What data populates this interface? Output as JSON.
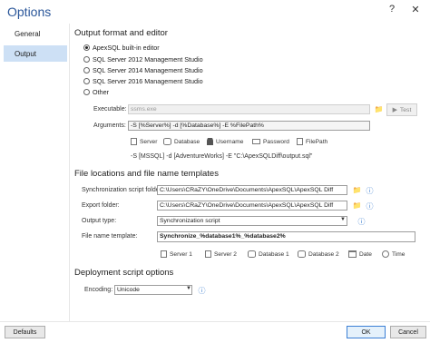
{
  "window": {
    "title": "Options",
    "help_icon": "?",
    "close_icon": "✕"
  },
  "sidebar": {
    "items": [
      {
        "label": "General",
        "active": false
      },
      {
        "label": "Output",
        "active": true
      }
    ]
  },
  "output_section": {
    "title": "Output format and editor",
    "options": [
      {
        "label": "ApexSQL built-in editor",
        "selected": true
      },
      {
        "label": "SQL Server 2012 Management Studio",
        "selected": false
      },
      {
        "label": "SQL Server 2014 Management Studio",
        "selected": false
      },
      {
        "label": "SQL Server 2016 Management Studio",
        "selected": false
      },
      {
        "label": "Other",
        "selected": false
      }
    ],
    "executable_label": "Executable:",
    "executable_placeholder": "ssms.exe",
    "test_label": "Test",
    "arguments_label": "Arguments:",
    "arguments_value": "-S [%Server%] -d [%Database%] -E %FilePath%",
    "tokens": [
      "Server",
      "Database",
      "Username",
      "Password",
      "FilePath"
    ],
    "preview": "-S [MSSQL] -d [AdventureWorks] -E \"C:\\ApexSQLDiff\\output.sql\""
  },
  "files_section": {
    "title": "File locations and file name templates",
    "sync_folder_label": "Synchronization script folder:",
    "sync_folder_value": "C:\\Users\\CRaZY\\OneDrive\\Documents\\ApexSQL\\ApexSQL Diff",
    "export_folder_label": "Export folder:",
    "export_folder_value": "C:\\Users\\CRaZY\\OneDrive\\Documents\\ApexSQL\\ApexSQL Diff",
    "output_type_label": "Output type:",
    "output_type_value": "Synchronization script",
    "file_template_label": "File name template:",
    "file_template_value": "Synchronize_%database1%_%database2%",
    "tokens": [
      "Server 1",
      "Server 2",
      "Database 1",
      "Database 2",
      "Date",
      "Time"
    ]
  },
  "deploy_section": {
    "title": "Deployment script options",
    "encoding_label": "Encoding:",
    "encoding_value": "Unicode"
  },
  "footer": {
    "defaults_label": "Defaults",
    "ok_label": "OK",
    "cancel_label": "Cancel"
  }
}
